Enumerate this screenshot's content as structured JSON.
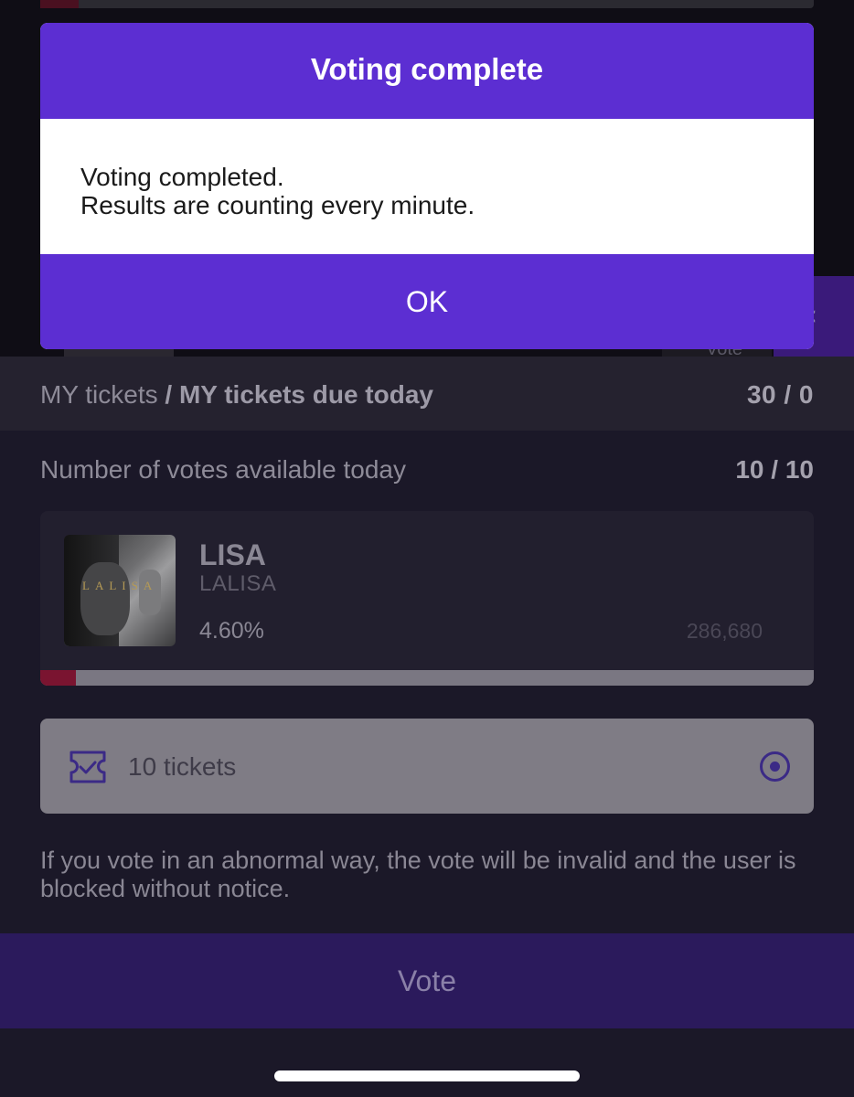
{
  "modal": {
    "title": "Voting complete",
    "message": "Voting completed.\nResults are counting every minute.",
    "ok_label": "OK"
  },
  "background": {
    "vote_fragment": "Vote"
  },
  "tickets_row": {
    "label": "MY tickets",
    "label_bold": " / MY tickets due today",
    "value": "30  /  0"
  },
  "votes_row": {
    "label": "Number of votes available today",
    "value": "10 / 10"
  },
  "artist": {
    "name": "LISA",
    "song": "LALISA",
    "percent": "4.60%",
    "count": "286,680",
    "album_word": "LALISA",
    "progress_fraction": 0.046
  },
  "ticket_option": {
    "label": "10 tickets",
    "icon": "ticket-check-icon",
    "selected": true
  },
  "notice": "If you vote in an abnormal way, the vote will be invalid and the user is blocked without notice.",
  "vote_button": "Vote",
  "colors": {
    "accent": "#5c2ed2",
    "progress": "#7a1430",
    "background": "#1b1828"
  }
}
